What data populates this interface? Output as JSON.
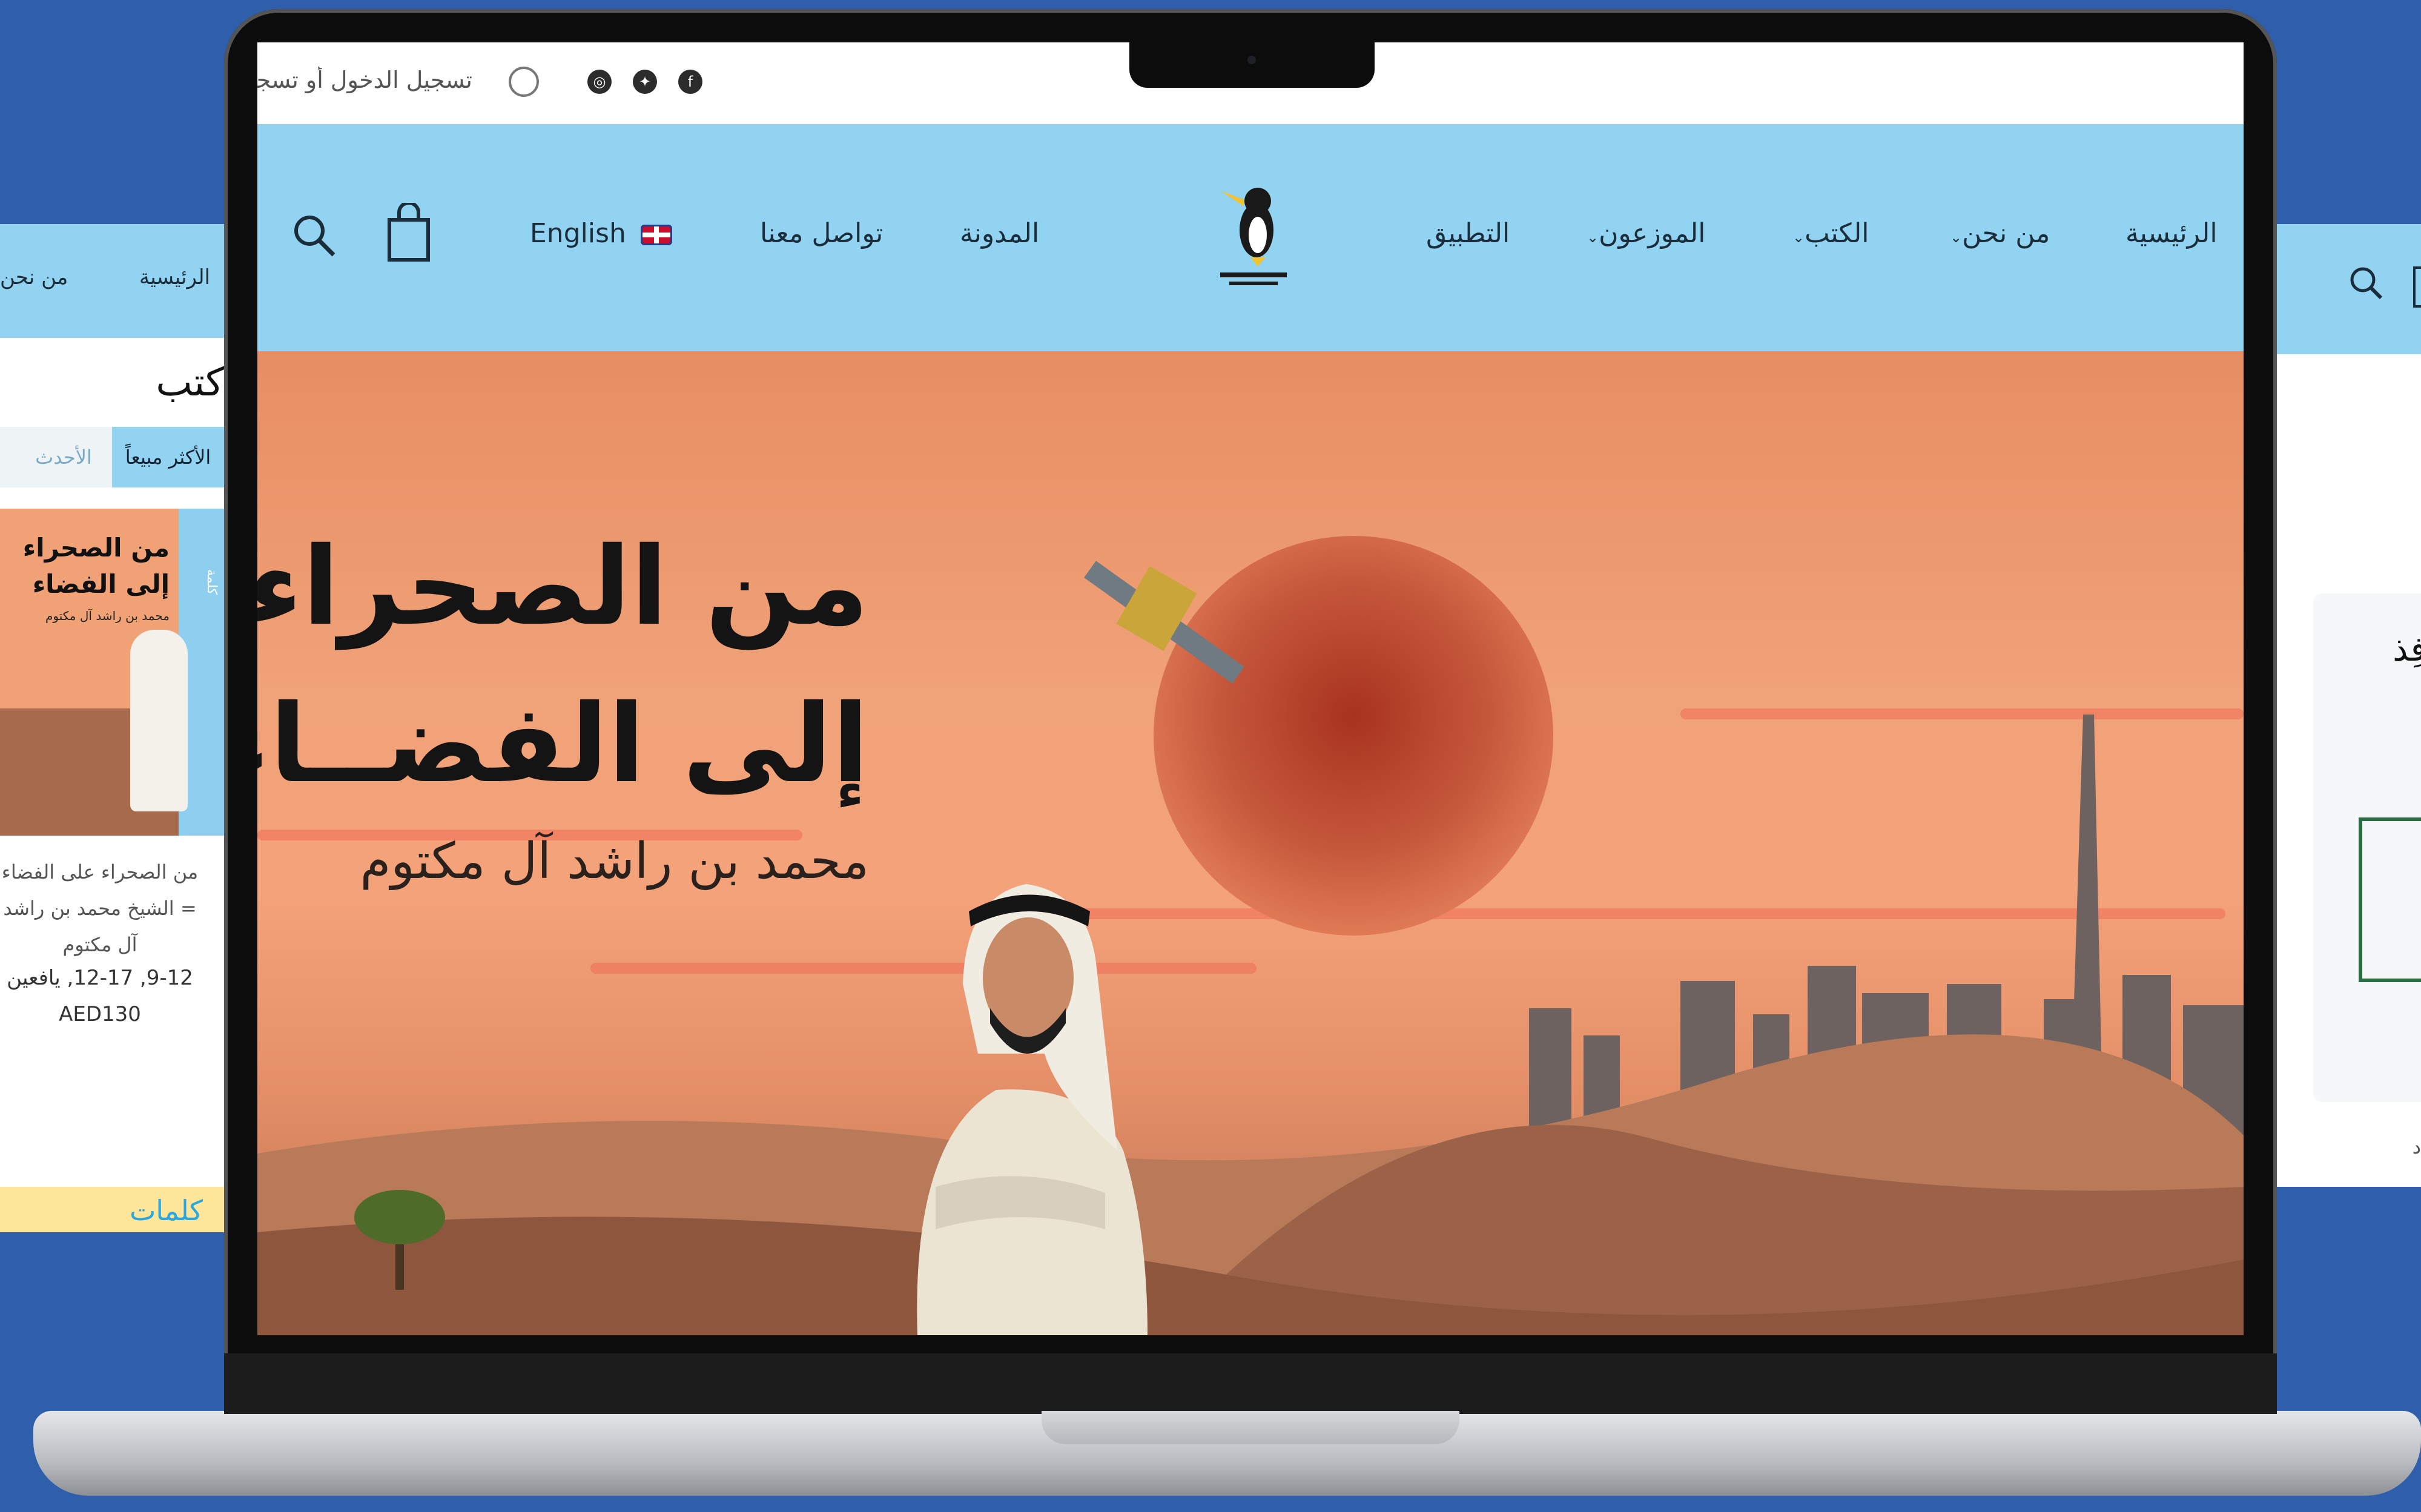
{
  "left_page": {
    "nav": {
      "home": "الرئيسية",
      "about": "من نحن"
    },
    "section_title": "كتب",
    "tabs": {
      "best_selling": "الأكثر مبيعاً",
      "newest": "الأحدث"
    },
    "book": {
      "cover_title_line1": "من الصحراء",
      "cover_title_line2": "إلى الفضاء",
      "cover_author": "محمد بن راشد آل مكتوم",
      "spine_text": "كلمة",
      "description": "من الصحراء على الفضاء = الشيخ محمد بن راشد آل مكتوم",
      "ages": "9-12, 12-17, يافعين",
      "price": "AED130"
    },
    "banner_text": "كلمات"
  },
  "right_page": {
    "card_text": "وافِذ",
    "small_text": "د"
  },
  "site": {
    "topbar": {
      "login_text": "تسجيل الدخول أو تسجيل",
      "social_icons": [
        "facebook-icon",
        "twitter-icon",
        "instagram-icon"
      ]
    },
    "nav": {
      "home": "الرئيسية",
      "about": "من نحن",
      "books": "الكتب",
      "distributors": "الموزعون",
      "app": "التطبيق",
      "blog": "المدونة",
      "contact": "تواصل معنا",
      "language": "English",
      "caret": "⌄"
    },
    "hero": {
      "title_line1": "من الصحراء",
      "title_line2": "إلى الفضــاء",
      "author": "محمد بن راشد آل مكتوم"
    }
  },
  "colors": {
    "background": "#2f5eab",
    "nav_blue": "#93d3f2",
    "hero_orange": "#f0a278",
    "planet": "#c4563a"
  }
}
